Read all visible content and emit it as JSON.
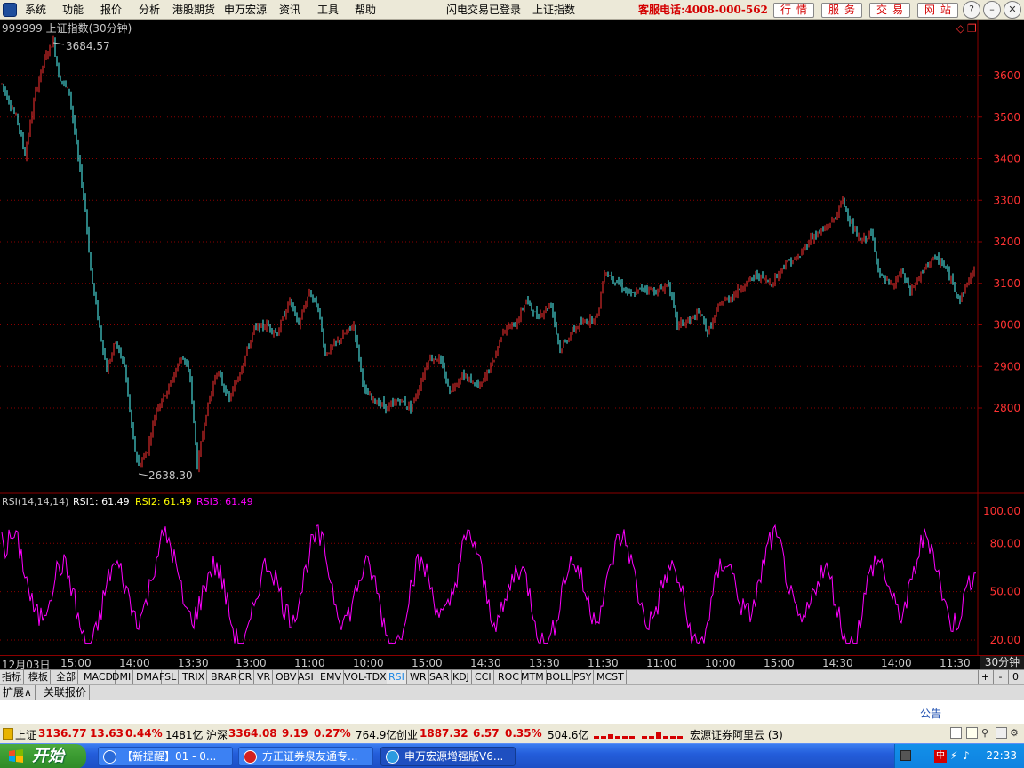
{
  "menubar": {
    "items": [
      "系统",
      "功能",
      "报价",
      "分析",
      "港股期货",
      "申万宏源",
      "资讯",
      "工具",
      "帮助"
    ],
    "login_status": "闪电交易已登录",
    "index_name": "上证指数",
    "phone": "客服电话:4008-000-562",
    "right_buttons": [
      "行情",
      "服务",
      "交易",
      "网站"
    ],
    "window_controls": [
      "?",
      "–",
      "❐",
      "✕"
    ]
  },
  "chart": {
    "title": "999999 上证指数(30分钟)",
    "high_label": "3684.57",
    "low_label": "2638.30",
    "y_ticks": [
      "3600",
      "3500",
      "3400",
      "3300",
      "3200",
      "3100",
      "3000",
      "2900",
      "2800"
    ],
    "y_values": [
      3600,
      3500,
      3400,
      3300,
      3200,
      3100,
      3000,
      2900,
      2800
    ],
    "high": 3684.57,
    "low": 2638.3,
    "up_color": "#ff3232",
    "down_color": "#54ffff",
    "grid_color": "#8b0000"
  },
  "rsi": {
    "title": "RSI(14,14,14)",
    "rsi1_label": "RSI1: 61.49",
    "rsi2_label": "RSI2: 61.49",
    "rsi3_label": "RSI3: 61.49",
    "y_ticks": [
      "100.00",
      "80.00",
      "50.00",
      "20.00"
    ],
    "y_values": [
      100,
      80,
      50,
      20
    ],
    "line_color": "#ff00ff"
  },
  "time_axis": {
    "labels": [
      "12月03日",
      "15:00",
      "14:00",
      "13:30",
      "13:00",
      "11:00",
      "10:00",
      "15:00",
      "14:30",
      "13:30",
      "11:30",
      "11:00",
      "10:00",
      "15:00",
      "14:30",
      "14:00",
      "11:30"
    ],
    "period": "30分钟"
  },
  "indicator_tabs": [
    "指标",
    "模板",
    "全部",
    "MACD",
    "DMI",
    "DMA",
    "FSL",
    "TRIX",
    "BRAR",
    "CR",
    "VR",
    "OBV",
    "ASI",
    "EMV",
    "VOL-TDX",
    "RSI",
    "WR",
    "SAR",
    "KDJ",
    "CCI",
    "ROC",
    "MTM",
    "BOLL",
    "PSY",
    "MCST"
  ],
  "active_indicator": "RSI",
  "indicator_controls": [
    "+",
    "-",
    "0"
  ],
  "ext_tabs": [
    "扩展∧",
    "关联报价"
  ],
  "notice": "公告",
  "status": {
    "sh_label": "上证",
    "sh_value": "3136.77",
    "sh_change": "13.63",
    "sh_pct": "0.44%",
    "sh_amount": "1481亿",
    "hs_label": "沪深",
    "hs_value": "3364.08",
    "hs_change": "9.19",
    "hs_pct": "0.27%",
    "hs_amount": "764.9亿",
    "cy_label": "创业",
    "cy_value": "1887.32",
    "cy_change": "6.57",
    "cy_pct": "0.35%",
    "cy_amount": "504.6亿",
    "broker": "宏源证券阿里云 (3)"
  },
  "taskbar": {
    "start": "开始",
    "tasks": [
      "【新提醒】01 - 0...",
      "方正证券泉友通专...",
      "申万宏源增强版V6..."
    ],
    "time": "22:33"
  }
}
